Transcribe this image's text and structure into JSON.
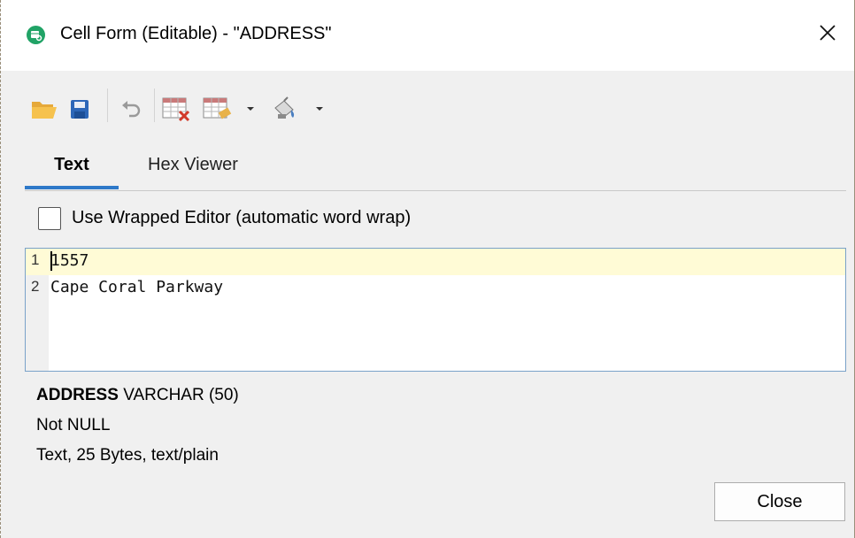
{
  "window": {
    "title": "Cell Form (Editable) - \"ADDRESS\"",
    "icon": "cell-form-app-icon"
  },
  "toolbar": {
    "items": [
      {
        "icon": "open-folder-icon"
      },
      {
        "icon": "save-disk-icon"
      },
      {
        "icon": "undo-icon"
      },
      {
        "icon": "grid-delete-icon"
      },
      {
        "icon": "grid-edit-icon"
      },
      {
        "icon": "dropdown-arrow-icon"
      },
      {
        "icon": "paint-bucket-icon"
      },
      {
        "icon": "dropdown-arrow-icon"
      }
    ]
  },
  "tabs": [
    {
      "label": "Text",
      "active": true
    },
    {
      "label": "Hex Viewer",
      "active": false
    }
  ],
  "options": {
    "wrap_label": "Use Wrapped Editor (automatic word wrap)",
    "wrap_checked": false
  },
  "editor": {
    "lines": [
      {
        "num": "1",
        "text": "1557"
      },
      {
        "num": "2",
        "text": "Cape Coral Parkway"
      }
    ]
  },
  "field_info": {
    "column_name": "ADDRESS",
    "column_type": "VARCHAR (50)",
    "nullability": "Not NULL",
    "content_summary": "Text, 25 Bytes, text/plain"
  },
  "footer": {
    "close_label": "Close"
  },
  "colors": {
    "accent": "#2e79c9",
    "active_line": "#fffbd6",
    "app_icon": "#21a366"
  }
}
